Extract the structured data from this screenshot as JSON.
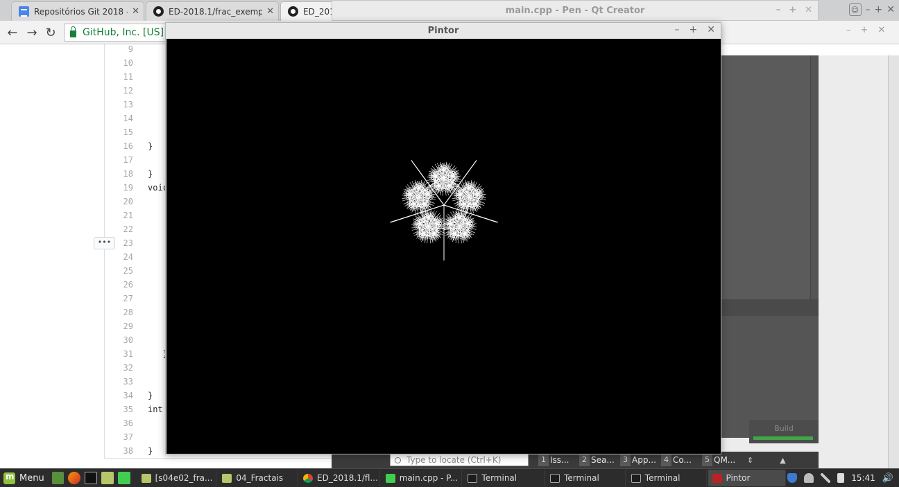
{
  "browser": {
    "tabs": [
      {
        "label": "Repositórios Git 2018 -",
        "icon": "docs-icon"
      },
      {
        "label": "ED-2018.1/frac_exempl",
        "icon": "github-icon"
      },
      {
        "label": "ED_201",
        "icon": "github-icon"
      }
    ],
    "omnibox": {
      "secure_origin": "GitHub, Inc. [US]"
    }
  },
  "code": {
    "lines": [
      {
        "n": "9",
        "text": ""
      },
      {
        "n": "10",
        "text": ""
      },
      {
        "n": "11",
        "text": ""
      },
      {
        "n": "12",
        "text": ""
      },
      {
        "n": "13",
        "text": ""
      },
      {
        "n": "14",
        "text": ""
      },
      {
        "n": "15",
        "text": ""
      },
      {
        "n": "16",
        "text": "}"
      },
      {
        "n": "17",
        "text": ""
      },
      {
        "n": "18",
        "text": "}"
      },
      {
        "n": "19",
        "text": "voic"
      },
      {
        "n": "20",
        "text": ""
      },
      {
        "n": "21",
        "text": ""
      },
      {
        "n": "22",
        "text": ""
      },
      {
        "n": "23",
        "text": ""
      },
      {
        "n": "24",
        "text": ""
      },
      {
        "n": "25",
        "text": ""
      },
      {
        "n": "26",
        "text": ""
      },
      {
        "n": "27",
        "text": ""
      },
      {
        "n": "28",
        "text": ""
      },
      {
        "n": "29",
        "text": ""
      },
      {
        "n": "30",
        "text": ""
      },
      {
        "n": "31",
        "text": "   }"
      },
      {
        "n": "32",
        "text": ""
      },
      {
        "n": "33",
        "text": ""
      },
      {
        "n": "34",
        "text": "}"
      },
      {
        "n": "35",
        "text": "int "
      },
      {
        "n": "36",
        "text": ""
      },
      {
        "n": "37",
        "text": ""
      },
      {
        "n": "38",
        "text": "}"
      }
    ],
    "expand_label": "•••"
  },
  "qt": {
    "title": "main.cpp - Pen - Qt Creator",
    "locator_placeholder": "Type to locate (Ctrl+K)",
    "output_panes": [
      {
        "num": "1",
        "label": "Iss..."
      },
      {
        "num": "2",
        "label": "Sea..."
      },
      {
        "num": "3",
        "label": "App..."
      },
      {
        "num": "4",
        "label": "Co..."
      },
      {
        "num": "5",
        "label": "QM..."
      }
    ],
    "build_label": "Build"
  },
  "pintor": {
    "title": "Pintor"
  },
  "panel": {
    "menu_label": "Menu",
    "windows": [
      {
        "label": "[s04e02_fra...",
        "icon": "folder-icon"
      },
      {
        "label": "04_Fractais",
        "icon": "folder-icon"
      },
      {
        "label": "ED_2018.1/fl...",
        "icon": "chrome-icon"
      },
      {
        "label": "main.cpp - P...",
        "icon": "qt-icon"
      },
      {
        "label": "Terminal",
        "icon": "terminal-icon"
      },
      {
        "label": "Terminal",
        "icon": "terminal-icon"
      },
      {
        "label": "Terminal",
        "icon": "terminal-icon"
      },
      {
        "label": "Pintor",
        "icon": "pintor-icon"
      }
    ],
    "clock": "15:41"
  }
}
